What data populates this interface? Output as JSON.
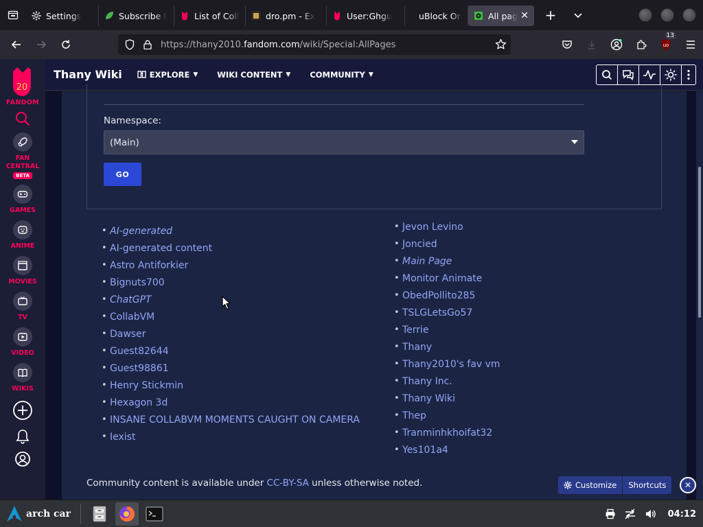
{
  "browser": {
    "tabs": [
      {
        "title": "Settings",
        "icon": "gear-icon",
        "icon_color": "#d0d0d7"
      },
      {
        "title": "Subscribe f",
        "icon": "leaf-icon",
        "icon_color": "#4caf50"
      },
      {
        "title": "List of Colla",
        "icon": "fandom-icon",
        "icon_color": "#fa005a"
      },
      {
        "title": "dro.pm - Ex",
        "icon": "page-icon",
        "icon_color": "#c9a15a"
      },
      {
        "title": "User:Ghgu",
        "icon": "fandom-icon",
        "icon_color": "#fa005a"
      },
      {
        "title": "uBlock Orig",
        "icon": "",
        "icon_color": ""
      },
      {
        "title": "All pages",
        "icon": "collabvm-icon",
        "icon_color": "#3dba3d",
        "active": true
      }
    ],
    "url": {
      "prefix": "https://thany2010.",
      "domain": "fandom.com",
      "path": "/wiki/Special:AllPages"
    },
    "extension_badge": "13"
  },
  "rail": {
    "brand": "FANDOM",
    "logo_text": "20",
    "items": [
      {
        "label_1": "FAN",
        "label_2": "CENTRAL",
        "badge": "BETA",
        "icon": "rocket-icon"
      },
      {
        "label": "GAMES",
        "icon": "gamepad-icon"
      },
      {
        "label": "ANIME",
        "icon": "anime-face-icon"
      },
      {
        "label": "MOVIES",
        "icon": "clapperboard-icon"
      },
      {
        "label": "TV",
        "icon": "tv-icon"
      },
      {
        "label": "VIDEO",
        "icon": "play-icon"
      },
      {
        "label": "WIKIS",
        "icon": "book-icon"
      }
    ]
  },
  "wiki": {
    "name": "Thany Wiki",
    "nav": [
      "EXPLORE",
      "WIKI CONTENT",
      "COMMUNITY"
    ]
  },
  "form": {
    "namespace_label": "Namespace:",
    "namespace_value": "(Main)",
    "go_label": "GO"
  },
  "pages_left": [
    {
      "title": "AI-generated",
      "italic": true
    },
    {
      "title": "AI-generated content",
      "italic": false
    },
    {
      "title": "Astro Antiforkier",
      "italic": false
    },
    {
      "title": "Bignuts700",
      "italic": false
    },
    {
      "title": "ChatGPT",
      "italic": true
    },
    {
      "title": "CollabVM",
      "italic": false
    },
    {
      "title": "Dawser",
      "italic": false
    },
    {
      "title": "Guest82644",
      "italic": false
    },
    {
      "title": "Guest98861",
      "italic": false
    },
    {
      "title": "Henry Stickmin",
      "italic": false
    },
    {
      "title": "Hexagon 3d",
      "italic": false
    },
    {
      "title": "INSANE COLLABVM MOMENTS CAUGHT ON CAMERA",
      "italic": false
    },
    {
      "title": "Iexist",
      "italic": false
    }
  ],
  "pages_right": [
    {
      "title": "Jevon Levino",
      "italic": false
    },
    {
      "title": "Joncied",
      "italic": false
    },
    {
      "title": "Main Page",
      "italic": true
    },
    {
      "title": "Monitor Animate",
      "italic": false
    },
    {
      "title": "ObedPollito285",
      "italic": false
    },
    {
      "title": "TSLGLetsGo57",
      "italic": false
    },
    {
      "title": "Terrie",
      "italic": false
    },
    {
      "title": "Thany",
      "italic": false
    },
    {
      "title": "Thany2010's fav vm",
      "italic": false
    },
    {
      "title": "Thany Inc.",
      "italic": false
    },
    {
      "title": "Thany Wiki",
      "italic": false
    },
    {
      "title": "Thep",
      "italic": false
    },
    {
      "title": "Tranminhkhoifat32",
      "italic": false
    },
    {
      "title": "Yes101a4",
      "italic": false
    }
  ],
  "footer": {
    "before": "Community content is available under ",
    "link": "CC-BY-SA",
    "after": " unless otherwise noted."
  },
  "customize_bar": {
    "customize": "Customize",
    "shortcuts": "Shortcuts"
  },
  "taskbar": {
    "start_label": "arch car",
    "clock": "04:12"
  },
  "colors": {
    "fandom_pink": "#fa005a",
    "link_blue": "#93a6f5",
    "go_button": "#2b48d6",
    "page_bg": "#1b2443"
  }
}
